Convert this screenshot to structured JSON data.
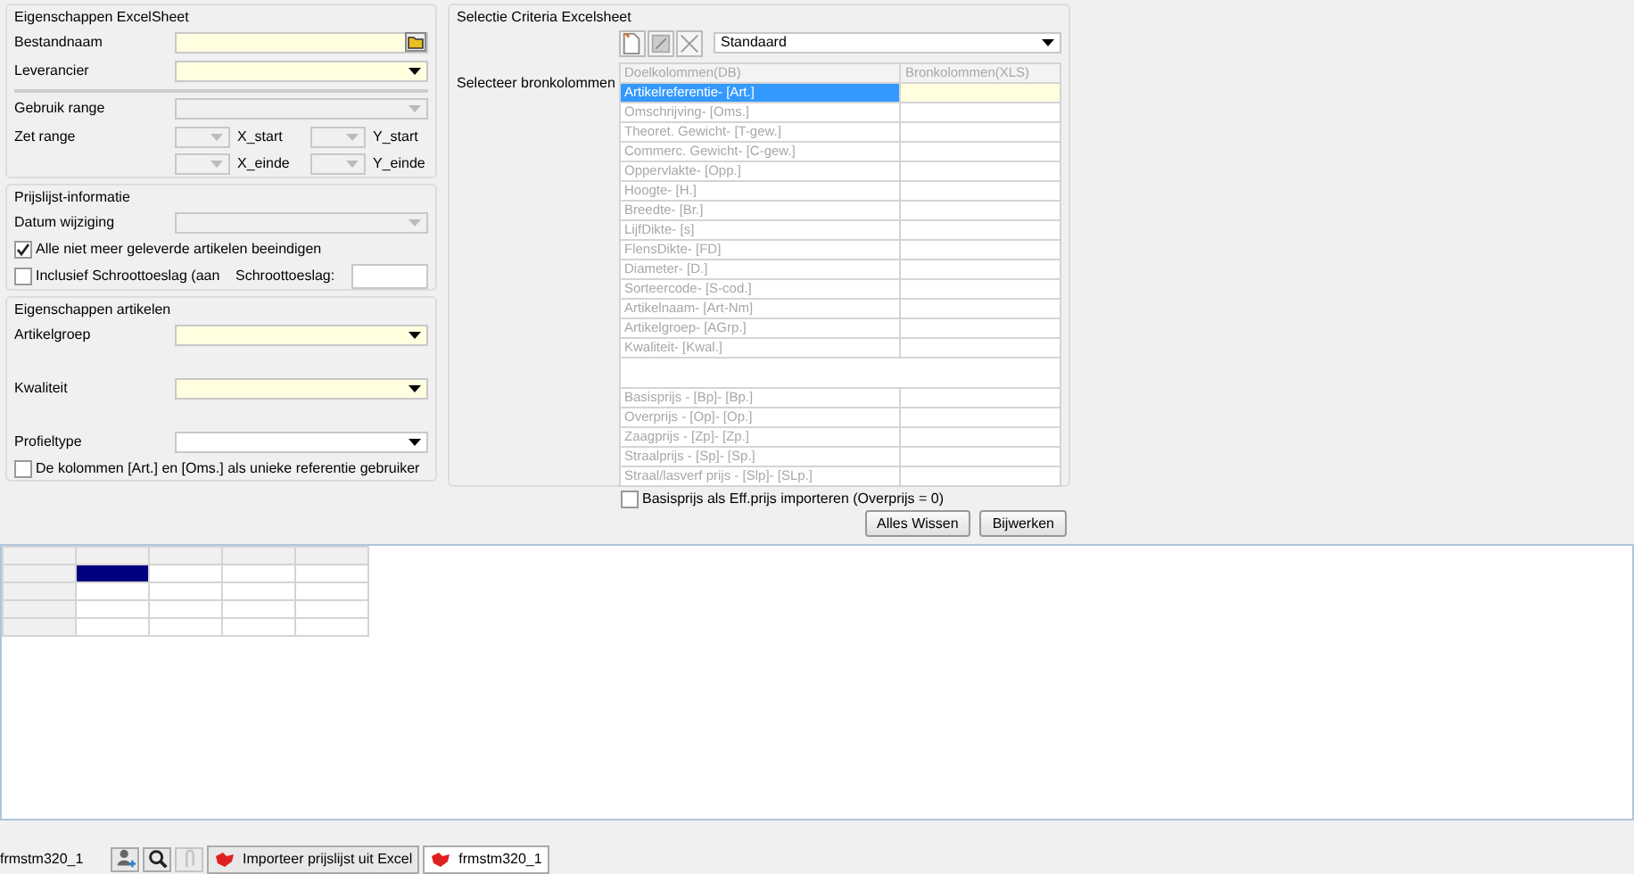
{
  "excel_sheet": {
    "title": "Eigenschappen ExcelSheet",
    "fields": [
      {
        "label": "Bestandnaam",
        "kind": "file",
        "required": true,
        "disabled": false
      },
      {
        "label": "Leverancier",
        "kind": "select",
        "required": true,
        "disabled": false
      }
    ],
    "range": {
      "label": "Gebruik range",
      "disabled": true
    },
    "set_range": {
      "label": "Zet range",
      "rows": [
        [
          "X_start",
          "Y_start"
        ],
        [
          "X_einde",
          "Y_einde"
        ]
      ]
    }
  },
  "price_list": {
    "title": "Prijslijst-informatie",
    "date": {
      "label": "Datum wijziging",
      "disabled": true
    },
    "end_articles": {
      "label": "Alle niet meer geleverde artikelen beeindigen",
      "checked": true
    },
    "scrap": {
      "label": "Inclusief Schroottoeslag (aan",
      "checked": false
    },
    "scrap_surcharge": {
      "label": "Schroottoeslag:"
    }
  },
  "articles": {
    "title": "Eigenschappen artikelen",
    "fields": [
      {
        "label": "Artikelgroep",
        "required": true
      },
      {
        "label": "Kwaliteit",
        "required": true
      },
      {
        "label": "Profieltype",
        "required": false
      }
    ],
    "unique_ref": {
      "label": "De kolommen [Art.] en [Oms.] als unieke referentie gebruiker",
      "checked": false
    }
  },
  "criteria": {
    "title": "Selectie Criteria Excelsheet",
    "profile": "Standaard",
    "columns_label": "Selecteer bronkolommen",
    "table": {
      "columns": [
        "Doelkolommen(DB)",
        "Bronkolommen(XLS)"
      ],
      "rows": [
        {
          "kind": "field",
          "target": "Artikelreferentie- [Art.]",
          "selected": true
        },
        {
          "kind": "field",
          "target": "Omschrijving- [Oms.]",
          "selected": false
        },
        {
          "kind": "field",
          "target": "Theoret. Gewicht- [T-gew.]",
          "selected": false
        },
        {
          "kind": "field",
          "target": "Commerc. Gewicht- [C-gew.]",
          "selected": false
        },
        {
          "kind": "field",
          "target": "Oppervlakte- [Opp.]",
          "selected": false
        },
        {
          "kind": "field",
          "target": "Hoogte- [H.]",
          "selected": false
        },
        {
          "kind": "field",
          "target": "Breedte- [Br.]",
          "selected": false
        },
        {
          "kind": "field",
          "target": "LijfDikte- [s]",
          "selected": false
        },
        {
          "kind": "field",
          "target": "FlensDikte- [FD]",
          "selected": false
        },
        {
          "kind": "field",
          "target": "Diameter- [D.]",
          "selected": false
        },
        {
          "kind": "field",
          "target": "Sorteercode- [S-cod.]",
          "selected": false
        },
        {
          "kind": "field",
          "target": "Artikelnaam- [Art-Nm]",
          "selected": false
        },
        {
          "kind": "field",
          "target": "Artikelgroep- [AGrp.]",
          "selected": false
        },
        {
          "kind": "field",
          "target": "Kwaliteit- [Kwal.]",
          "selected": false
        },
        {
          "kind": "separator"
        },
        {
          "kind": "field",
          "target": "Basisprijs - [Bp]- [Bp.]",
          "selected": false
        },
        {
          "kind": "field",
          "target": "Overprijs - [Op]- [Op.]",
          "selected": false
        },
        {
          "kind": "field",
          "target": "Zaagprijs - [Zp]- [Zp.]",
          "selected": false
        },
        {
          "kind": "field",
          "target": "Straalprijs - [Sp]- [Sp.]",
          "selected": false
        },
        {
          "kind": "field",
          "target": "Straal/lasverf prijs - [Slp]- [SLp.]",
          "selected": false
        }
      ]
    },
    "base_price": {
      "label": "Basisprijs als Eff.prijs importeren (Overprijs = 0)",
      "checked": false
    }
  },
  "buttons": [
    "Alles Wissen",
    "Bijwerken"
  ],
  "spreadsheet": {
    "rows": [
      {
        "cells": [
          {
            "selected": true
          },
          {
            "selected": false
          },
          {
            "selected": false
          },
          {
            "selected": false
          }
        ]
      },
      {
        "cells": [
          {
            "selected": false
          },
          {
            "selected": false
          },
          {
            "selected": false
          },
          {
            "selected": false
          }
        ]
      },
      {
        "cells": [
          {
            "selected": false
          },
          {
            "selected": false
          },
          {
            "selected": false
          },
          {
            "selected": false
          }
        ]
      },
      {
        "cells": [
          {
            "selected": false
          },
          {
            "selected": false
          },
          {
            "selected": false
          },
          {
            "selected": false
          }
        ]
      }
    ]
  },
  "taskbar": {
    "form": "frmstm320_1",
    "tools": [
      {
        "kind": "user-add",
        "disabled": false
      },
      {
        "kind": "search",
        "disabled": false
      },
      {
        "kind": "attach",
        "disabled": true
      }
    ],
    "tasks": [
      {
        "label": "Importeer prijslijst uit Excel",
        "selected": false
      },
      {
        "label": "frmstm320_1",
        "selected": true
      }
    ]
  }
}
